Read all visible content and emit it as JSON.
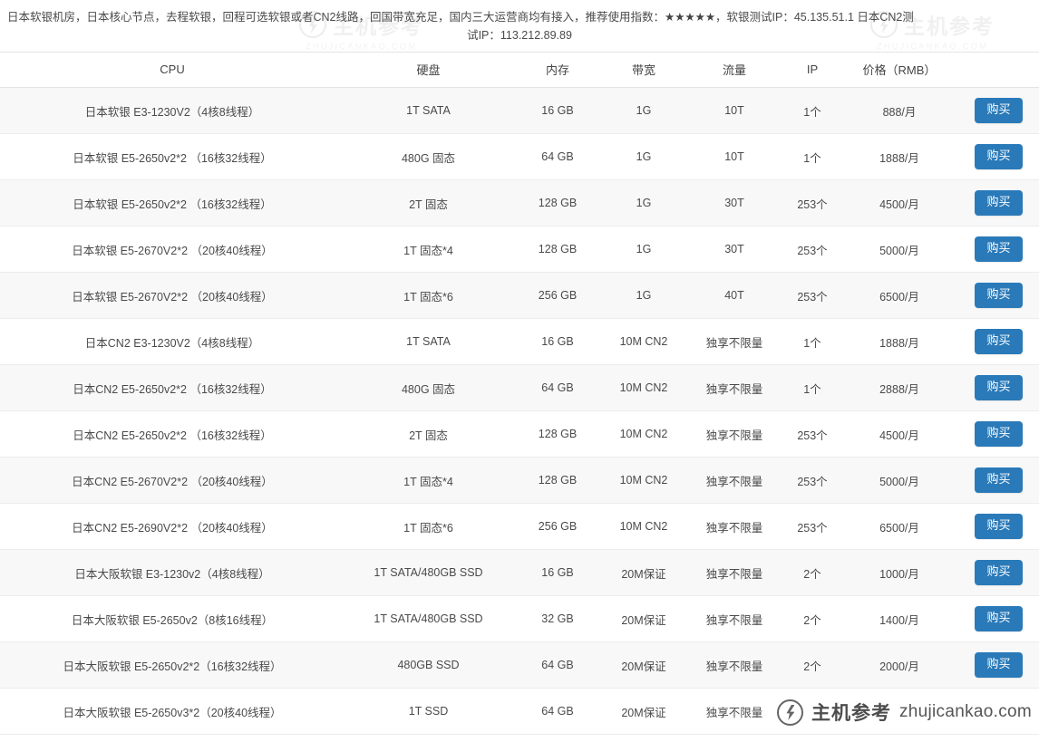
{
  "description": {
    "line1": "日本软银机房，日本核心节点，去程软银，回程可选软银或者CN2线路，回国带宽充足，国内三大运营商均有接入，推荐使用指数：",
    "stars": "★★★★★",
    "line1_tail": "，软银测试IP：45.135.51.1 日本CN2测",
    "line2": "试IP：113.212.89.89"
  },
  "table": {
    "headers": {
      "cpu": "CPU",
      "disk": "硬盘",
      "memory": "内存",
      "bandwidth": "带宽",
      "traffic": "流量",
      "ip": "IP",
      "price": "价格（RMB）",
      "action": ""
    },
    "buy_label": "购买",
    "rows": [
      {
        "cpu": "日本软银 E3-1230V2（4核8线程）",
        "disk": "1T SATA",
        "memory": "16 GB",
        "bandwidth": "1G",
        "traffic": "10T",
        "ip": "1个",
        "price": "888/月",
        "buy": "购买"
      },
      {
        "cpu": "日本软银 E5-2650v2*2 （16核32线程）",
        "disk": "480G 固态",
        "memory": "64 GB",
        "bandwidth": "1G",
        "traffic": "10T",
        "ip": "1个",
        "price": "1888/月",
        "buy": "购买"
      },
      {
        "cpu": "日本软银 E5-2650v2*2 （16核32线程）",
        "disk": "2T 固态",
        "memory": "128 GB",
        "bandwidth": "1G",
        "traffic": "30T",
        "ip": "253个",
        "price": "4500/月",
        "buy": "购买"
      },
      {
        "cpu": "日本软银 E5-2670V2*2 （20核40线程）",
        "disk": "1T 固态*4",
        "memory": "128 GB",
        "bandwidth": "1G",
        "traffic": "30T",
        "ip": "253个",
        "price": "5000/月",
        "buy": "购买"
      },
      {
        "cpu": "日本软银 E5-2670V2*2 （20核40线程）",
        "disk": "1T 固态*6",
        "memory": "256 GB",
        "bandwidth": "1G",
        "traffic": "40T",
        "ip": "253个",
        "price": "6500/月",
        "buy": "购买"
      },
      {
        "cpu": "日本CN2 E3-1230V2（4核8线程）",
        "disk": "1T SATA",
        "memory": "16 GB",
        "bandwidth": "10M CN2",
        "traffic": "独享不限量",
        "ip": "1个",
        "price": "1888/月",
        "buy": "购买"
      },
      {
        "cpu": "日本CN2 E5-2650v2*2 （16核32线程）",
        "disk": "480G 固态",
        "memory": "64 GB",
        "bandwidth": "10M CN2",
        "traffic": "独享不限量",
        "ip": "1个",
        "price": "2888/月",
        "buy": "购买"
      },
      {
        "cpu": "日本CN2 E5-2650v2*2 （16核32线程）",
        "disk": "2T 固态",
        "memory": "128 GB",
        "bandwidth": "10M CN2",
        "traffic": "独享不限量",
        "ip": "253个",
        "price": "4500/月",
        "buy": "购买"
      },
      {
        "cpu": "日本CN2 E5-2670V2*2 （20核40线程）",
        "disk": "1T 固态*4",
        "memory": "128 GB",
        "bandwidth": "10M CN2",
        "traffic": "独享不限量",
        "ip": "253个",
        "price": "5000/月",
        "buy": "购买"
      },
      {
        "cpu": "日本CN2 E5-2690V2*2 （20核40线程）",
        "disk": "1T 固态*6",
        "memory": "256 GB",
        "bandwidth": "10M CN2",
        "traffic": "独享不限量",
        "ip": "253个",
        "price": "6500/月",
        "buy": "购买"
      },
      {
        "cpu": "日本大阪软银 E3-1230v2（4核8线程）",
        "disk": "1T SATA/480GB SSD",
        "memory": "16 GB",
        "bandwidth": "20M保证",
        "traffic": "独享不限量",
        "ip": "2个",
        "price": "1000/月",
        "buy": "购买"
      },
      {
        "cpu": "日本大阪软银 E5-2650v2（8核16线程）",
        "disk": "1T SATA/480GB SSD",
        "memory": "32 GB",
        "bandwidth": "20M保证",
        "traffic": "独享不限量",
        "ip": "2个",
        "price": "1400/月",
        "buy": "购买"
      },
      {
        "cpu": "日本大阪软银 E5-2650v2*2（16核32线程）",
        "disk": "480GB SSD",
        "memory": "64 GB",
        "bandwidth": "20M保证",
        "traffic": "独享不限量",
        "ip": "2个",
        "price": "2000/月",
        "buy": "购买"
      },
      {
        "cpu": "日本大阪软银 E5-2650v3*2（20核40线程）",
        "disk": "1T SSD",
        "memory": "64 GB",
        "bandwidth": "20M保证",
        "traffic": "独享不限量",
        "ip": "",
        "price": "",
        "buy": ""
      }
    ]
  },
  "watermark": {
    "cn": "主机参考",
    "en": "ZHUJICANKAO.COM"
  },
  "brand": {
    "cn": "主机参考",
    "en": "zhujicankao.com"
  },
  "colors": {
    "buy_button": "#2a7ab9",
    "row_alt": "#f8f8f8",
    "text": "#4a4a4a"
  }
}
